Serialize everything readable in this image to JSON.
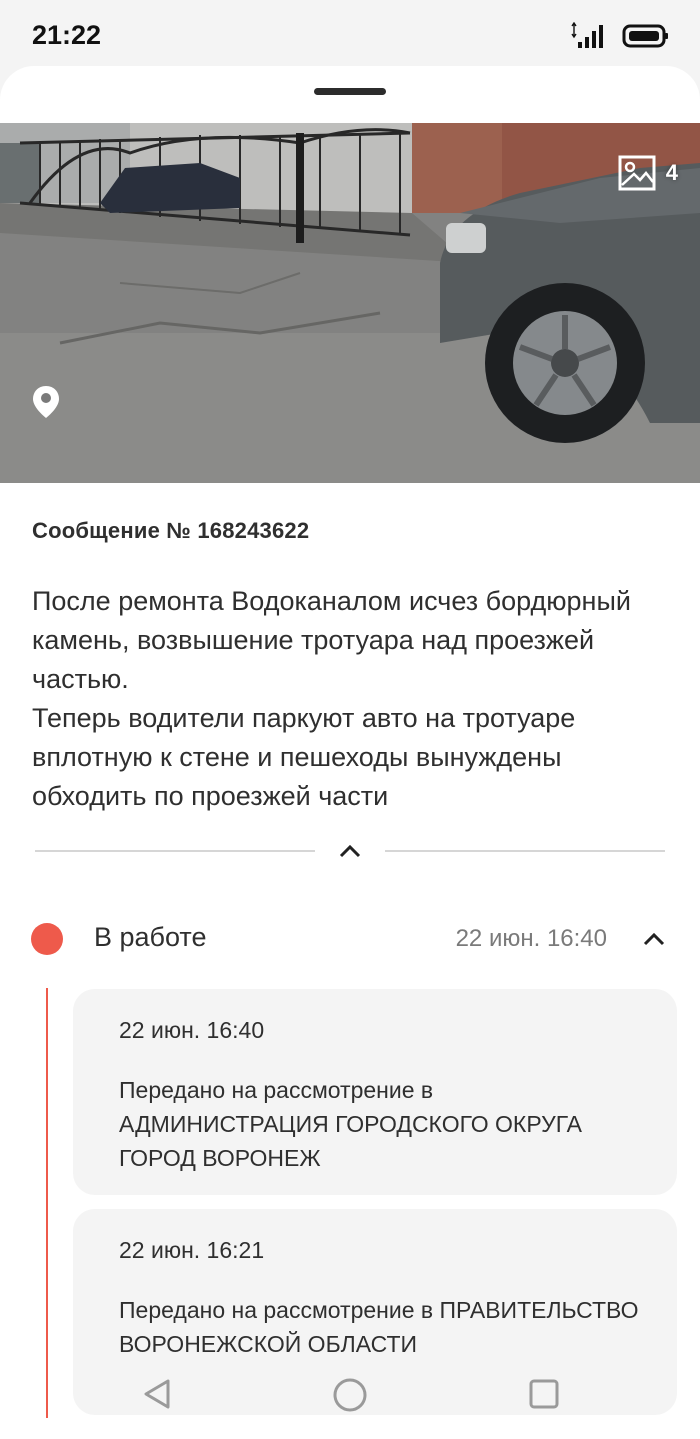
{
  "status_bar": {
    "time": "21:22"
  },
  "photo": {
    "count": "4"
  },
  "message": {
    "title": "Сообщение № 168243622",
    "body": "После ремонта Водоканалом исчез бордюрный камень, возвышение тротуара над проезжей частью.\nТеперь водители паркуют авто на тротуаре вплотную к стене и пешеходы вынуждены обходить по проезжей части"
  },
  "status": {
    "label": "В работе",
    "date": "22 июн. 16:40",
    "color": "#ee5a4b"
  },
  "history": [
    {
      "date": "22 июн. 16:40",
      "text": "Передано на рассмотрение в АДМИНИСТРАЦИЯ ГОРОДСКОГО ОКРУГА ГОРОД ВОРОНЕЖ"
    },
    {
      "date": "22 июн. 16:21",
      "text": "Передано на рассмотрение в ПРАВИТЕЛЬСТВО ВОРОНЕЖСКОЙ ОБЛАСТИ"
    }
  ],
  "icons": {
    "photo_count": "image-icon",
    "location": "location-pin-icon",
    "collapse": "chevron-up-icon",
    "nav_back": "back-triangle-icon",
    "nav_home": "home-circle-icon",
    "nav_recents": "recents-square-icon"
  }
}
